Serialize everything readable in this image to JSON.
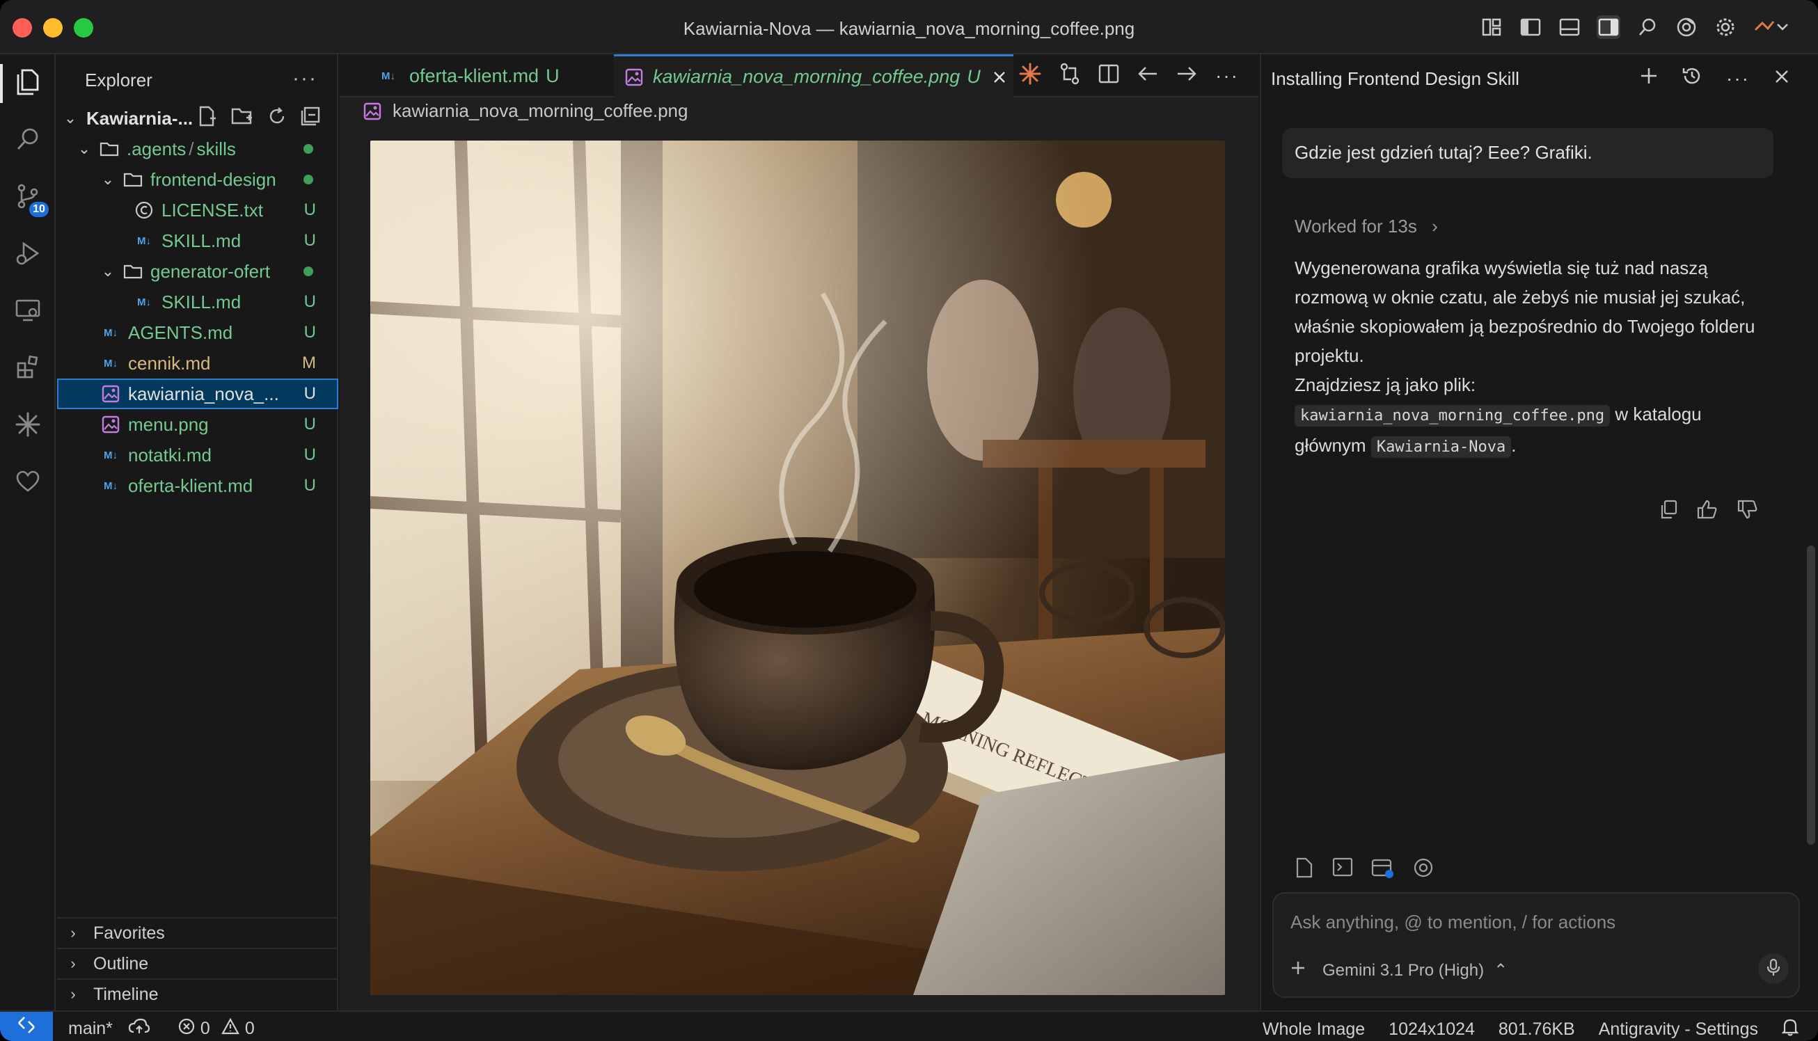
{
  "window": {
    "title": "Kawiarnia-Nova — kawiarnia_nova_morning_coffee.png"
  },
  "colors": {
    "accent": "#2a7fd4",
    "badge": "#1e6fd9",
    "untracked_green": "#74c991",
    "modified_orange": "#d7ba7d",
    "markdown_icon": "#4fa3e8",
    "image_icon": "#c57be0"
  },
  "activity_bar": {
    "items": [
      {
        "icon": "files-icon",
        "active": true
      },
      {
        "icon": "search-icon"
      },
      {
        "icon": "source-control-icon",
        "badge": "10"
      },
      {
        "icon": "run-debug-icon"
      },
      {
        "icon": "remote-explorer-icon"
      },
      {
        "icon": "extensions-icon"
      },
      {
        "icon": "agent-spark-icon"
      },
      {
        "icon": "heart-icon"
      }
    ]
  },
  "explorer": {
    "title": "Explorer",
    "more": "···",
    "root": "Kawiarnia-...",
    "tree": [
      {
        "name": ".agents",
        "sep": "/",
        "name2": "skills",
        "type": "folder",
        "status": "dot"
      },
      {
        "name": "frontend-design",
        "type": "folder",
        "status": "dot"
      },
      {
        "name": "LICENSE.txt",
        "type": "license",
        "status": "U"
      },
      {
        "name": "SKILL.md",
        "type": "md",
        "status": "U"
      },
      {
        "name": "generator-ofert",
        "type": "folder",
        "status": "dot"
      },
      {
        "name": "SKILL.md",
        "type": "md",
        "status": "U"
      },
      {
        "name": "AGENTS.md",
        "type": "md",
        "status": "U"
      },
      {
        "name": "cennik.md",
        "type": "md",
        "status": "M"
      },
      {
        "name": "kawiarnia_nova_...",
        "type": "img",
        "status": "U"
      },
      {
        "name": "menu.png",
        "type": "img",
        "status": "U"
      },
      {
        "name": "notatki.md",
        "type": "md",
        "status": "U"
      },
      {
        "name": "oferta-klient.md",
        "type": "md",
        "status": "U"
      }
    ],
    "sections": [
      "Favorites",
      "Outline",
      "Timeline"
    ]
  },
  "editor": {
    "tabs": [
      {
        "label": "oferta-klient.md",
        "status": "U"
      },
      {
        "label": "kawiarnia_nova_morning_coffee.png",
        "status": "U"
      }
    ],
    "md_badge": "M↓",
    "breadcrumb": "kawiarnia_nova_morning_coffee.png",
    "tab_more": "···"
  },
  "chat": {
    "title": "Installing Frontend Design Skill",
    "more": "···",
    "user_message": "Gdzie jest gdzień tutaj? Eee? Grafiki.",
    "worked": "Worked for 13s",
    "answer_p1": "Wygenerowana grafika wyświetla się tuż nad naszą rozmową w oknie czatu, ale żebyś nie musiał jej szukać, właśnie skopiowałem ją bezpośrednio do Twojego folderu projektu.",
    "answer_p2_prefix": "Znajdziesz ją jako plik:",
    "answer_code1": "kawiarnia_nova_morning_coffee.png",
    "answer_mid": "w katalogu głównym",
    "answer_code2": "Kawiarnia-Nova",
    "answer_end": ".",
    "input_placeholder": "Ask anything, @ to mention, / for actions",
    "model": "Gemini 3.1 Pro (High)"
  },
  "statusbar": {
    "branch": "main*",
    "errors": "0",
    "warnings": "0",
    "view_mode": "Whole Image",
    "dimensions": "1024x1024",
    "file_size": "801.76KB",
    "settings": "Antigravity - Settings"
  }
}
